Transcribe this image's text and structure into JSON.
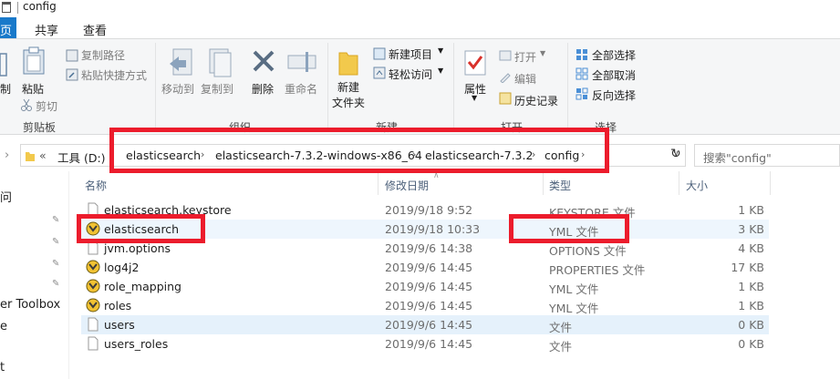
{
  "window": {
    "title": "config"
  },
  "tabs": [
    {
      "label": "页"
    },
    {
      "label": "共享"
    },
    {
      "label": "查看"
    }
  ],
  "ribbon": {
    "clipboard": {
      "cut_partial": "制",
      "paste": "粘贴",
      "copy_path": "复制路径",
      "paste_shortcut": "粘贴快捷方式",
      "cut": "剪切",
      "group": "剪贴板"
    },
    "organize": {
      "move_to": "移动到",
      "copy_to": "复制到",
      "delete": "删除",
      "rename": "重命名",
      "group": "组织"
    },
    "new": {
      "new_folder_1": "新建",
      "new_folder_2": "文件夹",
      "new_item": "新建项目",
      "easy_access": "轻松访问",
      "group": "新建"
    },
    "open": {
      "properties": "属性",
      "open": "打开",
      "edit": "编辑",
      "history": "历史记录",
      "group": "打开"
    },
    "select": {
      "select_all": "全部选择",
      "select_none": "全部取消",
      "invert": "反向选择",
      "group": "选择"
    }
  },
  "address": {
    "overflow": "«",
    "crumbs": [
      "工具 (D:)",
      "elasticsearch",
      "elasticsearch-7.3.2-windows-x86_64",
      "elasticsearch-7.3.2",
      "config"
    ],
    "search_placeholder": "搜索\"config\""
  },
  "nav": {
    "items": [
      "问",
      "er Toolbox",
      "e",
      "t"
    ]
  },
  "columns": {
    "name": "名称",
    "modified": "修改日期",
    "type": "类型",
    "size": "大小"
  },
  "files": [
    {
      "name": "elasticsearch.keystore",
      "modified": "2019/9/18 9:52",
      "type": "KEYSTORE 文件",
      "size": "1 KB",
      "icon": "file-icon"
    },
    {
      "name": "elasticsearch",
      "modified": "2019/9/18 10:33",
      "type": "YML 文件",
      "size": "3 KB",
      "icon": "yml-icon"
    },
    {
      "name": "jvm.options",
      "modified": "2019/9/6 14:38",
      "type": "OPTIONS 文件",
      "size": "4 KB",
      "icon": "file-icon"
    },
    {
      "name": "log4j2",
      "modified": "2019/9/6 14:45",
      "type": "PROPERTIES 文件",
      "size": "17 KB",
      "icon": "yml-icon"
    },
    {
      "name": "role_mapping",
      "modified": "2019/9/6 14:45",
      "type": "YML 文件",
      "size": "1 KB",
      "icon": "yml-icon"
    },
    {
      "name": "roles",
      "modified": "2019/9/6 14:45",
      "type": "YML 文件",
      "size": "1 KB",
      "icon": "yml-icon"
    },
    {
      "name": "users",
      "modified": "2019/9/6 14:45",
      "type": "文件",
      "size": "0 KB",
      "icon": "file-icon"
    },
    {
      "name": "users_roles",
      "modified": "2019/9/6 14:45",
      "type": "文件",
      "size": "0 KB",
      "icon": "file-icon"
    }
  ],
  "colors": {
    "highlight": "#ec1c2c",
    "selection": "#e5f1fb",
    "tab_active": "#1979ca"
  }
}
